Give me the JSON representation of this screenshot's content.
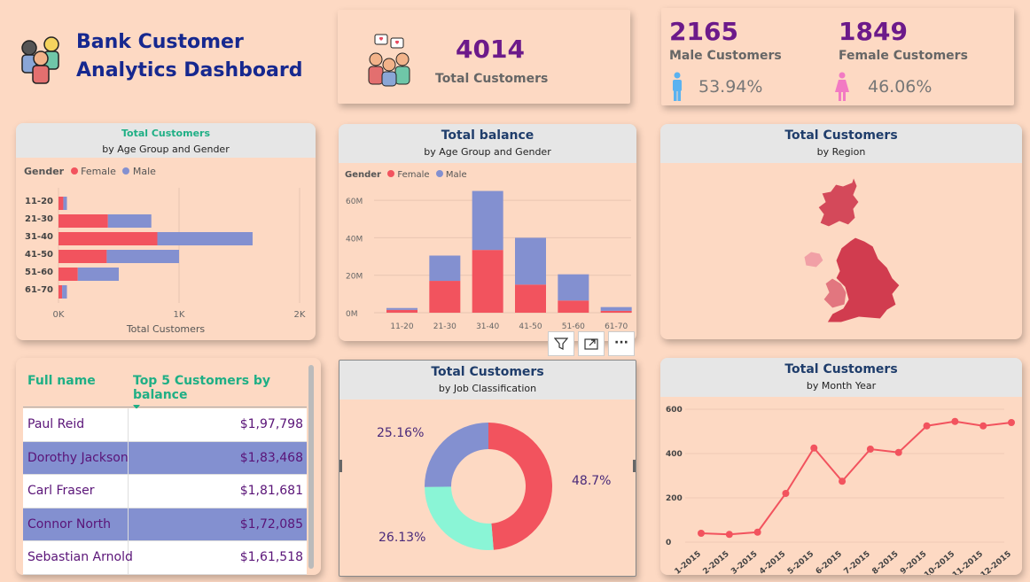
{
  "header": {
    "title_line1": "Bank Customer",
    "title_line2": "Analytics Dashboard"
  },
  "kpi_total": {
    "value": "4014",
    "label": "Total Customers"
  },
  "kpi_gender": {
    "male_value": "2165",
    "male_label": "Male Customers",
    "male_pct": "53.94%",
    "female_value": "1849",
    "female_label": "Female Customers",
    "female_pct": "46.06%"
  },
  "colors": {
    "female": "#f2535e",
    "male": "#8390d0",
    "teal": "#1faf85",
    "navy": "#1f3d6b"
  },
  "age_customers": {
    "title": "Total Customers",
    "subtitle": "by Age Group and Gender",
    "legend_title": "Gender",
    "legend_female": "Female",
    "legend_male": "Male",
    "xlabel": "Total Customers"
  },
  "balance_chart": {
    "title": "Total balance",
    "subtitle": "by Age Group and Gender",
    "legend_title": "Gender",
    "legend_female": "Female",
    "legend_male": "Male"
  },
  "region_chart": {
    "title": "Total Customers",
    "subtitle": "by Region"
  },
  "job_chart": {
    "title": "Total Customers",
    "subtitle": "by Job Classification"
  },
  "month_chart": {
    "title": "Total Customers",
    "subtitle": "by Month Year"
  },
  "toolbar": {
    "filter_icon": "filter-icon",
    "focus_icon": "focus-mode-icon",
    "more_label": "···"
  },
  "top_table": {
    "col_name": "Full name",
    "col_balance": "Top 5 Customers by balance",
    "rows": [
      {
        "name": "Paul Reid",
        "balance": "$1,97,798"
      },
      {
        "name": "Dorothy Jackson",
        "balance": "$1,83,468"
      },
      {
        "name": "Carl Fraser",
        "balance": "$1,81,681"
      },
      {
        "name": "Connor North",
        "balance": "$1,72,085"
      },
      {
        "name": "Sebastian Arnold",
        "balance": "$1,61,518"
      }
    ]
  },
  "chart_data": [
    {
      "type": "bar",
      "orientation": "horizontal",
      "stacked": true,
      "title": "Total Customers",
      "subtitle": "by Age Group and Gender",
      "categories": [
        "11-20",
        "21-30",
        "31-40",
        "41-50",
        "51-60",
        "61-70"
      ],
      "series": [
        {
          "name": "Female",
          "values": [
            40,
            410,
            820,
            400,
            160,
            30
          ]
        },
        {
          "name": "Male",
          "values": [
            30,
            360,
            790,
            600,
            340,
            40
          ]
        }
      ],
      "xlabel": "Total Customers",
      "xlim": [
        0,
        2000
      ],
      "xticks": [
        "0K",
        "1K",
        "2K"
      ],
      "legend": "top-left"
    },
    {
      "type": "bar",
      "stacked": true,
      "title": "Total balance",
      "subtitle": "by Age Group and Gender",
      "categories": [
        "11-20",
        "21-30",
        "31-40",
        "41-50",
        "51-60",
        "61-70"
      ],
      "series": [
        {
          "name": "Female",
          "values": [
            1.5,
            17,
            33.5,
            15,
            6.5,
            1
          ]
        },
        {
          "name": "Male",
          "values": [
            1,
            13.5,
            31.5,
            25,
            14,
            2
          ]
        }
      ],
      "ylim": [
        0,
        70
      ],
      "yticks": [
        "0M",
        "20M",
        "40M",
        "60M"
      ],
      "legend": "top-left"
    },
    {
      "type": "pie",
      "donut": true,
      "title": "Total Customers",
      "subtitle": "by Job Classification",
      "slices": [
        {
          "value": 48.7,
          "label": "48.7%",
          "color": "#f2535e"
        },
        {
          "value": 26.13,
          "label": "26.13%",
          "color": "#8af5d6"
        },
        {
          "value": 25.16,
          "label": "25.16%",
          "color": "#8390d0"
        }
      ]
    },
    {
      "type": "line",
      "title": "Total Customers",
      "subtitle": "by Month Year",
      "x": [
        "1-2015",
        "2-2015",
        "3-2015",
        "4-2015",
        "5-2015",
        "6-2015",
        "7-2015",
        "8-2015",
        "9-2015",
        "10-2015",
        "11-2015",
        "12-2015"
      ],
      "y": [
        40,
        35,
        45,
        220,
        425,
        275,
        420,
        405,
        525,
        545,
        525,
        540
      ],
      "ylim": [
        0,
        600
      ],
      "yticks": [
        "0",
        "200",
        "400",
        "600"
      ]
    }
  ]
}
